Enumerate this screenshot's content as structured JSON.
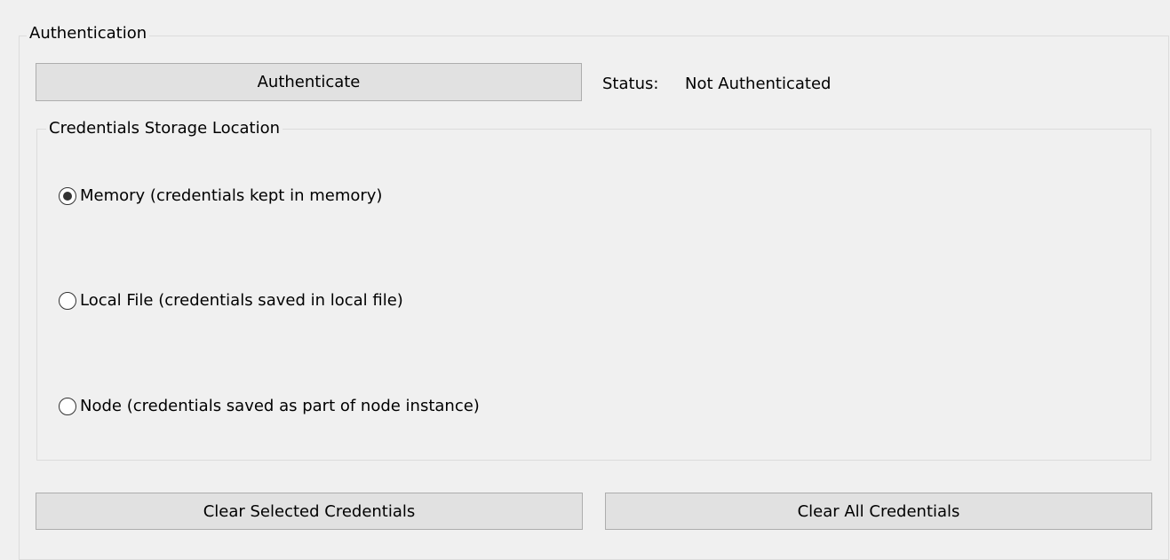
{
  "authentication": {
    "group_title": "Authentication",
    "authenticate_label": "Authenticate",
    "status_label": "Status:",
    "status_value": "Not Authenticated"
  },
  "storage": {
    "group_title": "Credentials Storage Location",
    "options": [
      {
        "label": "Memory (credentials kept in memory)",
        "selected": true
      },
      {
        "label": "Local File (credentials saved in local file)",
        "selected": false
      },
      {
        "label": "Node (credentials saved as part of node instance)",
        "selected": false
      }
    ]
  },
  "actions": {
    "clear_selected_label": "Clear Selected Credentials",
    "clear_all_label": "Clear All Credentials"
  },
  "colors": {
    "panel_background": "#f0f0f0",
    "button_face": "#e1e1e1",
    "button_border": "#adadad",
    "group_border": "#dcdcdc"
  }
}
